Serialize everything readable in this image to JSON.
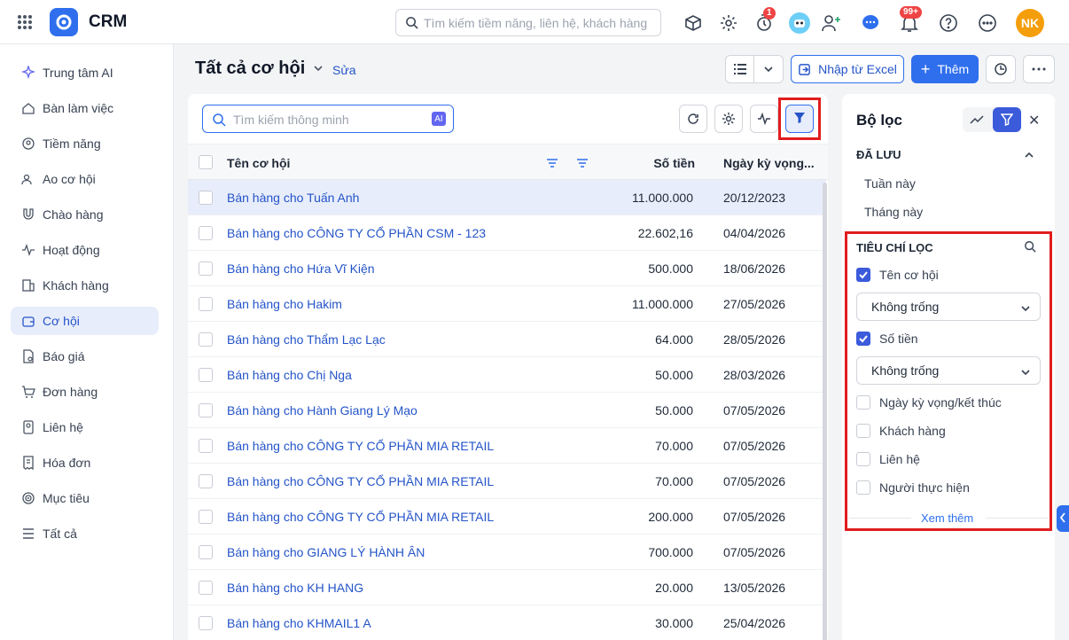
{
  "app": {
    "title": "CRM",
    "user_initials": "NK"
  },
  "search": {
    "placeholder": "Tìm kiếm tiềm năng, liên hệ, khách hàng"
  },
  "badges": {
    "timer": "1",
    "notifications": "99+"
  },
  "sidebar": {
    "items": [
      {
        "label": "Trung tâm AI",
        "icon": "sparkle-icon"
      },
      {
        "label": "Bàn làm việc",
        "icon": "home-icon"
      },
      {
        "label": "Tiềm năng",
        "icon": "target-user-icon"
      },
      {
        "label": "Ao cơ hội",
        "icon": "users-icon"
      },
      {
        "label": "Chào hàng",
        "icon": "magnet-icon"
      },
      {
        "label": "Hoạt động",
        "icon": "activity-icon"
      },
      {
        "label": "Khách hàng",
        "icon": "building-icon"
      },
      {
        "label": "Cơ hội",
        "icon": "wallet-icon",
        "active": true
      },
      {
        "label": "Báo giá",
        "icon": "quote-icon"
      },
      {
        "label": "Đơn hàng",
        "icon": "cart-icon"
      },
      {
        "label": "Liên hệ",
        "icon": "contact-icon"
      },
      {
        "label": "Hóa đơn",
        "icon": "invoice-icon"
      },
      {
        "label": "Mục tiêu",
        "icon": "goal-icon"
      },
      {
        "label": "Tất cả",
        "icon": "menu-icon"
      }
    ]
  },
  "header": {
    "title": "Tất cả cơ hội",
    "edit_label": "Sửa",
    "import_label": "Nhập từ Excel",
    "add_label": "Thêm"
  },
  "list": {
    "smart_search_placeholder": "Tìm kiếm thông minh",
    "ai_label": "AI",
    "columns": {
      "name": "Tên cơ hội",
      "amount": "Số tiền",
      "date": "Ngày kỳ vọng..."
    },
    "rows": [
      {
        "name": "Bán hàng cho Tuấn Anh",
        "amount": "11.000.000",
        "date": "20/12/2023"
      },
      {
        "name": "Bán hàng cho CÔNG TY CỔ PHẦN CSM - 123",
        "amount": "22.602,16",
        "date": "04/04/2026"
      },
      {
        "name": "Bán hàng cho Hứa Vĩ Kiện",
        "amount": "500.000",
        "date": "18/06/2026"
      },
      {
        "name": "Bán hàng cho Hakim",
        "amount": "11.000.000",
        "date": "27/05/2026"
      },
      {
        "name": "Bán hàng cho Thẩm Lạc Lạc",
        "amount": "64.000",
        "date": "28/05/2026"
      },
      {
        "name": "Bán hàng cho Chị Nga",
        "amount": "50.000",
        "date": "28/03/2026"
      },
      {
        "name": "Bán hàng cho Hành Giang Lý Mạo",
        "amount": "50.000",
        "date": "07/05/2026"
      },
      {
        "name": "Bán hàng cho CÔNG TY CỔ PHẦN MIA RETAIL",
        "amount": "70.000",
        "date": "07/05/2026"
      },
      {
        "name": "Bán hàng cho CÔNG TY CỔ PHẦN MIA RETAIL",
        "amount": "70.000",
        "date": "07/05/2026"
      },
      {
        "name": "Bán hàng cho CÔNG TY CỔ PHẦN MIA RETAIL",
        "amount": "200.000",
        "date": "07/05/2026"
      },
      {
        "name": "Bán hàng cho GIANG LÝ HÀNH ÂN",
        "amount": "700.000",
        "date": "07/05/2026"
      },
      {
        "name": "Bán hàng cho KH HANG",
        "amount": "20.000",
        "date": "13/05/2026"
      },
      {
        "name": "Bán hàng cho KHMAIL1 A",
        "amount": "30.000",
        "date": "25/04/2026"
      }
    ]
  },
  "filter": {
    "title": "Bộ lọc",
    "saved_title": "ĐÃ LƯU",
    "saved": [
      "Tuần này",
      "Tháng này"
    ],
    "criteria_title": "TIÊU CHÍ LỌC",
    "criteria": [
      {
        "label": "Tên cơ hội",
        "checked": true,
        "value": "Không trống"
      },
      {
        "label": "Số tiền",
        "checked": true,
        "value": "Không trống"
      },
      {
        "label": "Ngày kỳ vọng/kết thúc",
        "checked": false
      },
      {
        "label": "Khách hàng",
        "checked": false
      },
      {
        "label": "Liên hệ",
        "checked": false
      },
      {
        "label": "Người thực hiện",
        "checked": false
      }
    ],
    "see_more": "Xem thêm"
  }
}
